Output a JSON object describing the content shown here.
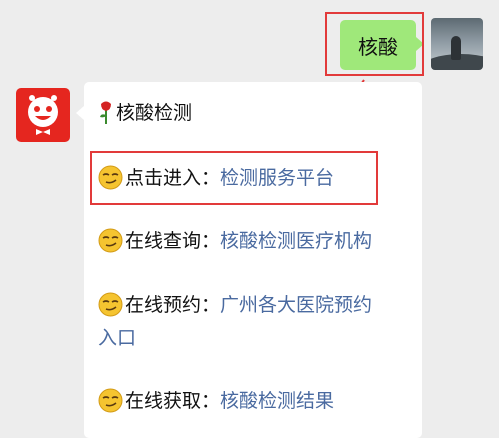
{
  "chat": {
    "outgoing_message": "核酸",
    "bot_message": {
      "title": "核酸检测",
      "items": [
        {
          "prefix": "点击进入：",
          "link": "检测服务平台"
        },
        {
          "prefix": "在线查询：",
          "link": "核酸检测医疗机构"
        },
        {
          "prefix": "在线预约：",
          "link": "广州各大医院预约",
          "link_cont": "入口"
        },
        {
          "prefix": "在线获取：",
          "link": "核酸检测结果"
        }
      ]
    }
  },
  "colors": {
    "outgoing_bubble": "#9fe87a",
    "link": "#4a6aa0",
    "highlight": "#e23a3a",
    "bot_avatar_bg": "#e5261f",
    "chat_bg": "#ededed"
  },
  "icons": {
    "rose": "rose-icon",
    "smirk": "smirk-emoji-icon",
    "bot_avatar": "red-robot-face-avatar",
    "my_avatar": "landscape-photo-avatar"
  }
}
